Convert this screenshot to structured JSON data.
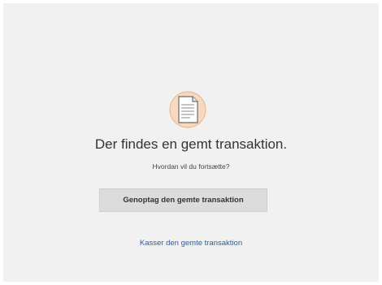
{
  "dialog": {
    "icon": "saved-document-icon",
    "title": "Der findes en gemt transaktion.",
    "subtitle": "Hvordan vil du fortsætte?",
    "resume_label": "Genoptag den gemte transaktion",
    "discard_label": "Kasser den gemte transaktion"
  },
  "colors": {
    "background": "#f1f1f1",
    "button": "#dcdcdc",
    "link": "#2b5fa8",
    "icon_circle": "#f7d9bf"
  }
}
